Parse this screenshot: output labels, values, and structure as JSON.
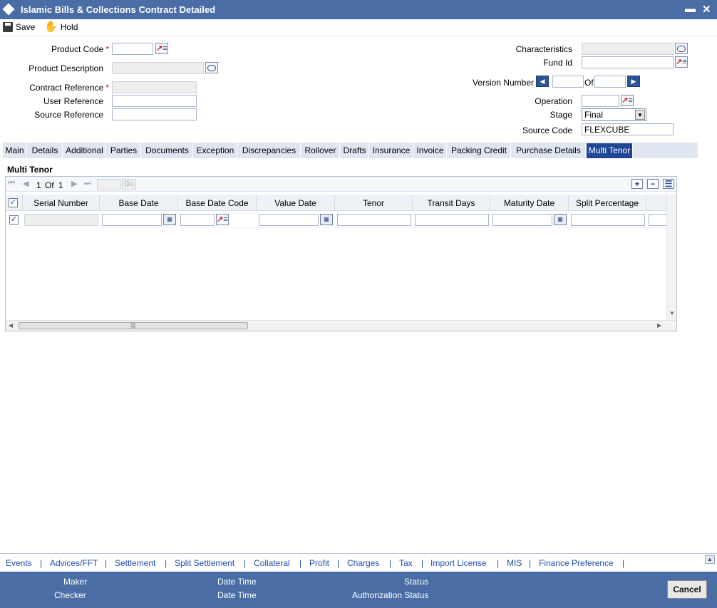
{
  "window": {
    "title": "Islamic Bills & Collections Contract Detailed",
    "minimize_glyph": "▬",
    "close_glyph": "✕"
  },
  "toolbar": {
    "save_label": "Save",
    "hold_label": "Hold"
  },
  "form": {
    "product_code_label": "Product Code",
    "product_description_label": "Product Description",
    "contract_reference_label": "Contract Reference",
    "user_reference_label": "User Reference",
    "source_reference_label": "Source Reference",
    "characteristics_label": "Characteristics",
    "fund_id_label": "Fund Id",
    "version_number_label": "Version Number",
    "version_of_label": "Of",
    "operation_label": "Operation",
    "stage_label": "Stage",
    "stage_value": "Final",
    "source_code_label": "Source Code",
    "source_code_value": "FLEXCUBE",
    "required_marker": "*"
  },
  "tabs": [
    {
      "label": "Main"
    },
    {
      "label": "Details"
    },
    {
      "label": "Additional"
    },
    {
      "label": "Parties"
    },
    {
      "label": "Documents"
    },
    {
      "label": "Exception"
    },
    {
      "label": "Discrepancies"
    },
    {
      "label": "Rollover"
    },
    {
      "label": "Drafts"
    },
    {
      "label": "Insurance"
    },
    {
      "label": "Invoice"
    },
    {
      "label": "Packing Credit"
    },
    {
      "label": "Purchase Details"
    },
    {
      "label": "Multi Tenor"
    }
  ],
  "section": {
    "title": "Multi Tenor"
  },
  "pager": {
    "current": "1",
    "of_label": "Of",
    "total": "1",
    "go_label": "Go"
  },
  "grid": {
    "columns": [
      "Serial Number",
      "Base Date",
      "Base Date Code",
      "Value Date",
      "Tenor",
      "Transit Days",
      "Maturity Date",
      "Split Percentage"
    ]
  },
  "bottom_links": [
    "Events",
    "Advices/FFT",
    "Settlement",
    "Split Settlement",
    "Collateral",
    "Profit",
    "Charges",
    "Tax",
    "Import License",
    "MIS",
    "Finance Preference"
  ],
  "link_separator": "|",
  "footer": {
    "maker_label": "Maker",
    "checker_label": "Checker",
    "date_time_label_1": "Date Time",
    "date_time_label_2": "Date Time",
    "status_label": "Status",
    "authorization_status_label": "Authorization Status",
    "cancel_label": "Cancel"
  },
  "colors": {
    "titlebar": "#4a6da6",
    "active_tab": "#1f4794",
    "link": "#1f4fb0"
  }
}
